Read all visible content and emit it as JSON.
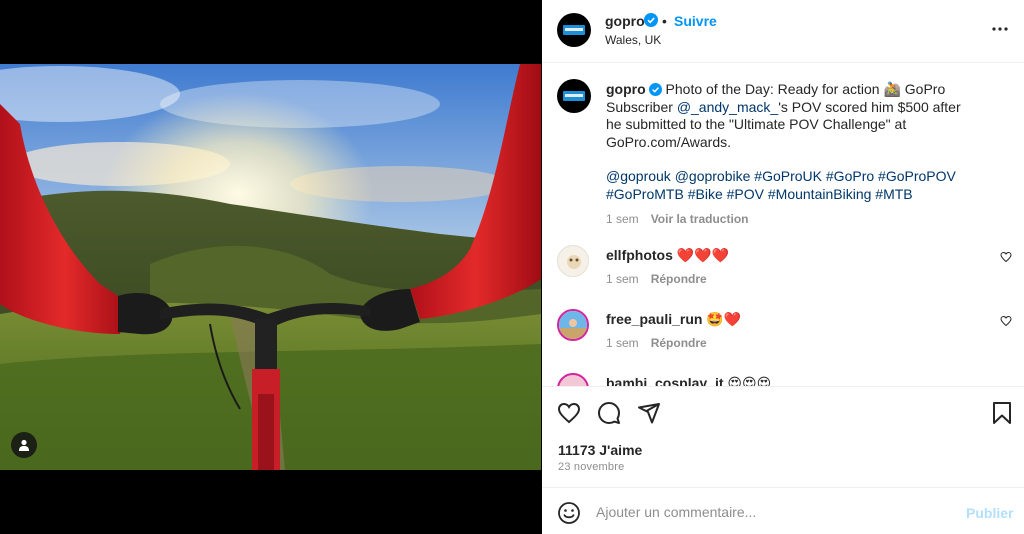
{
  "post": {
    "username": "gopro",
    "follow_label": "Suivre",
    "separator": "•",
    "location": "Wales, UK",
    "more_icon": "more-options-icon"
  },
  "caption": {
    "username": "gopro",
    "text_before_mention": " Photo of the Day: Ready for action 🚵 GoPro Subscriber ",
    "mention": "@_andy_mack_",
    "text_after_mention": "'s POV scored him $500 after he submitted to the \"Ultimate POV Challenge\" at GoPro.com/Awards.",
    "tags": [
      "@goprouk",
      "@goprobike",
      "#GoProUK",
      "#GoPro",
      "#GoProPOV",
      "#GoProMTB",
      "#Bike",
      "#POV",
      "#MountainBiking",
      "#MTB"
    ],
    "time": "1 sem",
    "translate_label": "Voir la traduction"
  },
  "comments": [
    {
      "username": "ellfphotos",
      "text": "❤️❤️❤️",
      "time": "1 sem",
      "reply_label": "Répondre"
    },
    {
      "username": "free_pauli_run",
      "text": "🤩❤️",
      "time": "1 sem",
      "reply_label": "Répondre"
    },
    {
      "username": "bambi_cosplay_it",
      "text": "😍😍😍",
      "time": "",
      "reply_label": ""
    }
  ],
  "stats": {
    "likes": "11173 J'aime",
    "date": "23 novembre"
  },
  "composer": {
    "placeholder": "Ajouter un commentaire...",
    "publish_label": "Publier"
  },
  "colors": {
    "accent": "#0095f6",
    "link": "#00376b",
    "muted": "#8e8e8e",
    "publish_disabled": "#b2dffc"
  }
}
